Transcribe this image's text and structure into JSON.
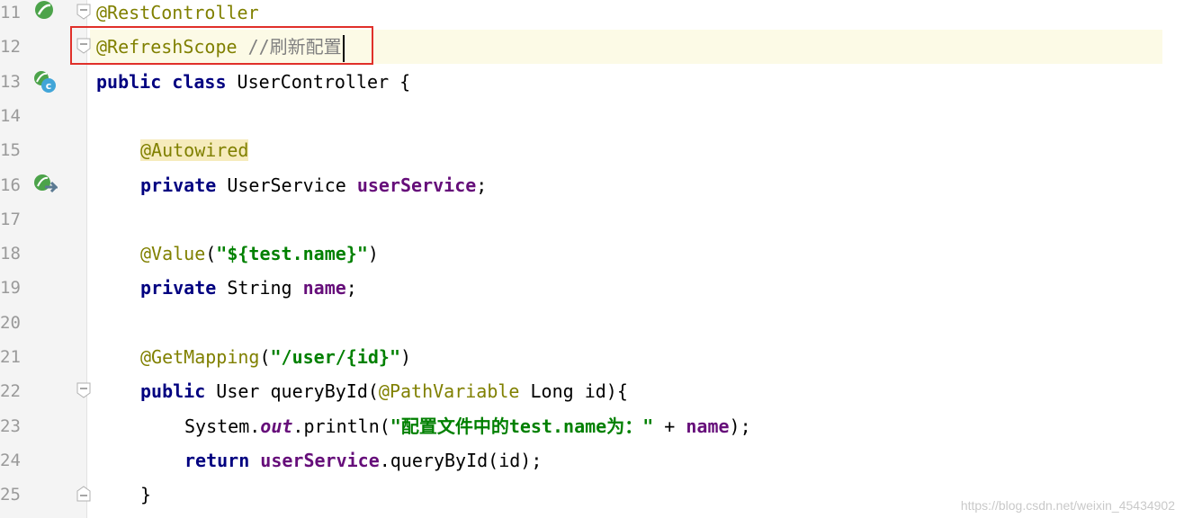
{
  "lines": [
    {
      "num": "11",
      "parts": [
        {
          "t": "@RestController",
          "c": "ann"
        }
      ]
    },
    {
      "num": "12",
      "parts": [
        {
          "t": "@RefreshScope",
          "c": "ann"
        },
        {
          "t": " //刷新配置",
          "c": "cmt"
        }
      ]
    },
    {
      "num": "13",
      "parts": [
        {
          "t": "public",
          "c": "kw"
        },
        {
          "t": " "
        },
        {
          "t": "class",
          "c": "kw"
        },
        {
          "t": " UserController {"
        }
      ]
    },
    {
      "num": "14",
      "parts": []
    },
    {
      "num": "15",
      "parts": [
        {
          "t": "@Autowired",
          "c": "ann autowired-hl"
        }
      ]
    },
    {
      "num": "16",
      "parts": [
        {
          "t": "private",
          "c": "kw"
        },
        {
          "t": " UserService "
        },
        {
          "t": "userService",
          "c": "field"
        },
        {
          "t": ";"
        }
      ]
    },
    {
      "num": "17",
      "parts": []
    },
    {
      "num": "18",
      "parts": [
        {
          "t": "@Value",
          "c": "ann"
        },
        {
          "t": "("
        },
        {
          "t": "\"${test.name}\"",
          "c": "str"
        },
        {
          "t": ")"
        }
      ]
    },
    {
      "num": "19",
      "parts": [
        {
          "t": "private",
          "c": "kw"
        },
        {
          "t": " String "
        },
        {
          "t": "name",
          "c": "field"
        },
        {
          "t": ";"
        }
      ]
    },
    {
      "num": "20",
      "parts": []
    },
    {
      "num": "21",
      "parts": [
        {
          "t": "@GetMapping",
          "c": "ann"
        },
        {
          "t": "("
        },
        {
          "t": "\"/user/{id}\"",
          "c": "str"
        },
        {
          "t": ")"
        }
      ]
    },
    {
      "num": "22",
      "parts": [
        {
          "t": "public",
          "c": "kw"
        },
        {
          "t": " User queryById("
        },
        {
          "t": "@PathVariable",
          "c": "ann"
        },
        {
          "t": " Long id){"
        }
      ]
    },
    {
      "num": "23",
      "parts": [
        {
          "t": "System."
        },
        {
          "t": "out",
          "c": "static"
        },
        {
          "t": ".println("
        },
        {
          "t": "\"配置文件中的test.name为：\"",
          "c": "str"
        },
        {
          "t": " + "
        },
        {
          "t": "name",
          "c": "field"
        },
        {
          "t": ");"
        }
      ]
    },
    {
      "num": "24",
      "parts": [
        {
          "t": "return",
          "c": "kw"
        },
        {
          "t": " "
        },
        {
          "t": "userService",
          "c": "field"
        },
        {
          "t": ".queryById(id);"
        }
      ]
    },
    {
      "num": "25",
      "parts": [
        {
          "t": "}"
        }
      ]
    }
  ],
  "watermark": "https://blog.csdn.net/weixin_45434902"
}
